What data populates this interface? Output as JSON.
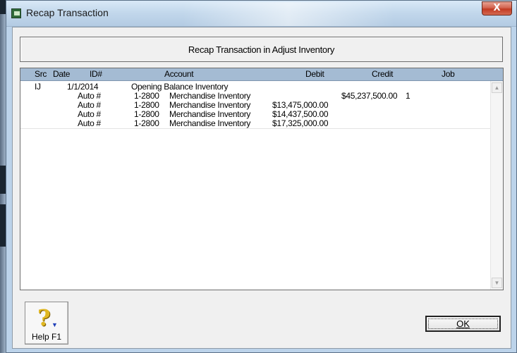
{
  "window": {
    "title": "Recap Transaction",
    "close_glyph": "X"
  },
  "heading": "Recap Transaction in Adjust Inventory",
  "columns": {
    "src": "Src",
    "date": "Date",
    "id": "ID#",
    "account": "Account",
    "debit": "Debit",
    "credit": "Credit",
    "job": "Job"
  },
  "rows": [
    {
      "src": "IJ",
      "date": "1/1/2014",
      "id": "",
      "acct_no": "Opening Balance Inventory",
      "acct_name": "",
      "debit": "",
      "credit": "",
      "job": ""
    },
    {
      "src": "",
      "date": "",
      "id": "Auto #",
      "acct_no": "1-2800",
      "acct_name": "Merchandise Inventory",
      "debit": "",
      "credit": "$45,237,500.00",
      "job": "1"
    },
    {
      "src": "",
      "date": "",
      "id": "Auto #",
      "acct_no": "1-2800",
      "acct_name": "Merchandise Inventory",
      "debit": "$13,475,000.00",
      "credit": "",
      "job": ""
    },
    {
      "src": "",
      "date": "",
      "id": "Auto #",
      "acct_no": "1-2800",
      "acct_name": "Merchandise Inventory",
      "debit": "$14,437,500.00",
      "credit": "",
      "job": ""
    },
    {
      "src": "",
      "date": "",
      "id": "Auto #",
      "acct_no": "1-2800",
      "acct_name": "Merchandise Inventory",
      "debit": "$17,325,000.00",
      "credit": "",
      "job": ""
    }
  ],
  "buttons": {
    "help_label": "Help F1",
    "help_icon": "question-mark-icon",
    "help_glyph": "?",
    "ok_label": "OK"
  }
}
